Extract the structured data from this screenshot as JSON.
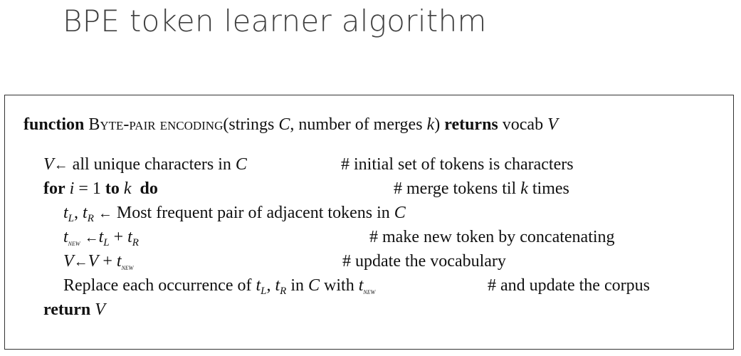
{
  "slide": {
    "title": "BPE token learner algorithm"
  },
  "algorithm": {
    "header": {
      "kw_function": "function",
      "name_first": "B",
      "name_rest": "yte-pair encoding",
      "open": "(strings ",
      "param_c": "C",
      "mid": ", number of merges ",
      "param_k": "k",
      "close": ") ",
      "kw_returns": "returns",
      "returns_text": " vocab ",
      "returns_var": "V"
    },
    "line1": {
      "var": "V",
      "arrow": "←",
      "text": " all unique characters in ",
      "var_c": "C",
      "comment": "# initial set of tokens is characters"
    },
    "line2": {
      "kw_for": "for",
      "var_i": "i",
      "eq": " = 1 ",
      "kw_to": "to",
      "var_k": "k",
      "kw_do": "do",
      "comment_pre": "# merge tokens til ",
      "comment_k": "k",
      "comment_post": " times"
    },
    "line3": {
      "t": "t",
      "sub_l": "L",
      "comma": ", ",
      "sub_r": "R",
      "arrow": "←",
      "text": " Most frequent pair of adjacent tokens in ",
      "var_c": "C"
    },
    "line4": {
      "t": "t",
      "sub_new": "new",
      "arrow": "←",
      "sub_l": "L",
      "plus": " + ",
      "sub_r": "R",
      "comment": "# make new token by concatenating"
    },
    "line5": {
      "var": "V",
      "arrow": "←",
      "plus": " + ",
      "t": "t",
      "sub_new": "new",
      "comment": "# update the vocabulary"
    },
    "line6": {
      "text": "Replace each occurrence of ",
      "t": "t",
      "sub_l": "L",
      "comma": ", ",
      "sub_r": "R",
      "in": " in ",
      "var_c": "C",
      "with": " with ",
      "sub_new": "new",
      "comment": "# and update the corpus"
    },
    "line7": {
      "kw_return": "return",
      "var": "V"
    }
  }
}
